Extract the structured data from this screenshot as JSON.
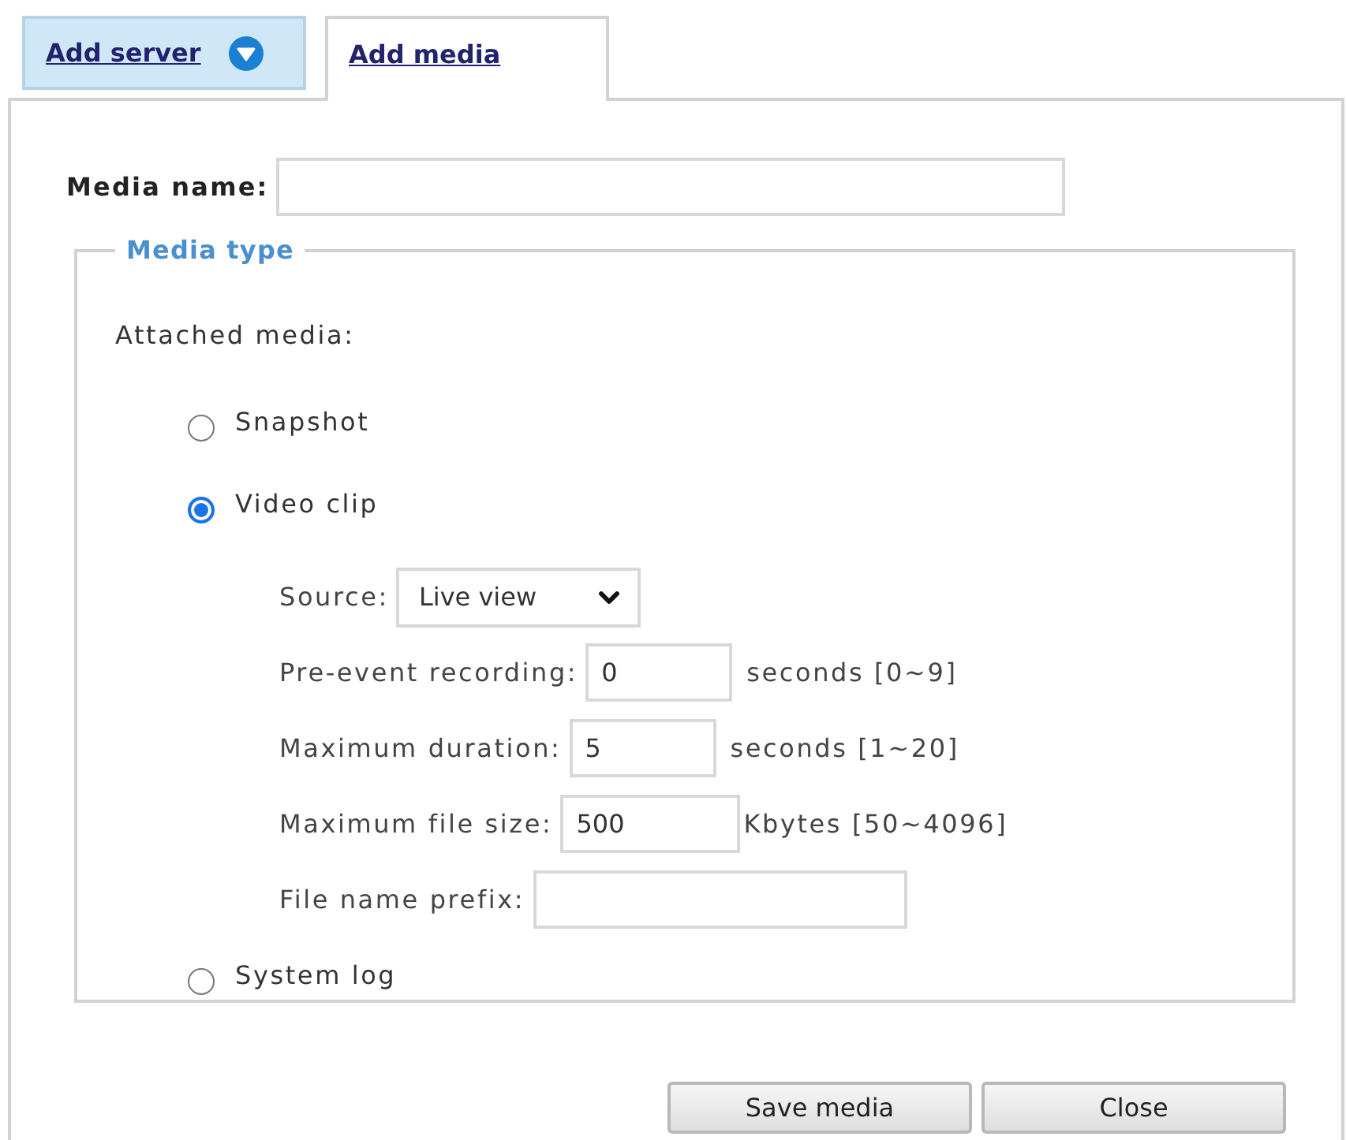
{
  "tabs": [
    {
      "label": "Add server",
      "kind": "menu",
      "selected": false
    },
    {
      "label": "Add media",
      "kind": "link",
      "selected": true
    }
  ],
  "media_name": {
    "label": "Media name:"
  },
  "media_type": {
    "legend": "Media type",
    "prompt": "Attached media:",
    "options": [
      {
        "label": "Snapshot",
        "selected": false
      },
      {
        "label": "Video clip",
        "selected": true,
        "settings": [
          {
            "kind": "select",
            "label": "Source:",
            "value": "Live view"
          },
          {
            "kind": "text",
            "label": "Pre-event recording:",
            "value": "0",
            "unit": "seconds [0~9]"
          },
          {
            "kind": "text",
            "label": "Maximum duration:",
            "value": "5",
            "unit": "seconds [1~20]"
          },
          {
            "kind": "text",
            "label": "Maximum file size:",
            "value": "500",
            "unit": "Kbytes [50~4096]"
          },
          {
            "kind": "text",
            "label": "File name prefix:"
          }
        ]
      },
      {
        "label": "System log",
        "selected": false
      }
    ]
  },
  "buttons": [
    {
      "label": "Save media"
    },
    {
      "label": "Close"
    }
  ]
}
